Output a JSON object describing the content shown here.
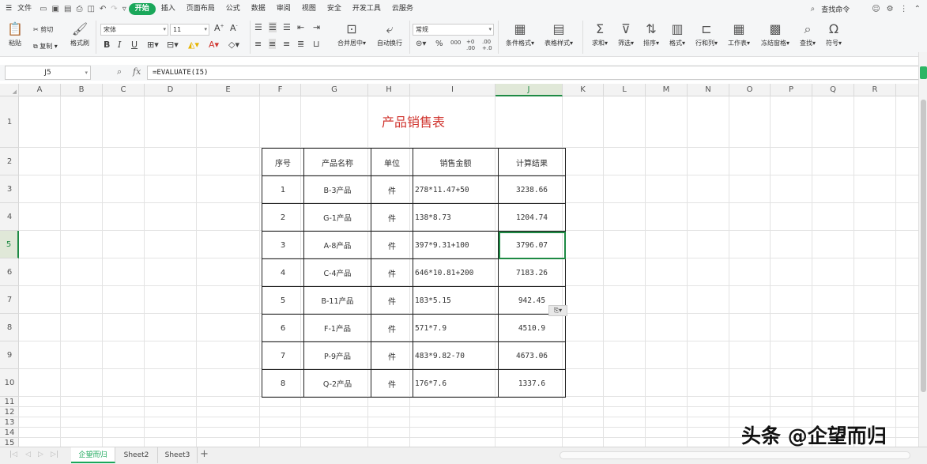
{
  "menubar": {
    "file": "文件",
    "tabs": [
      "开始",
      "插入",
      "页面布局",
      "公式",
      "数据",
      "审阅",
      "视图",
      "安全",
      "开发工具",
      "云服务"
    ],
    "active_tab": "开始",
    "search_cmd": "查找命令"
  },
  "ribbon": {
    "paste": "粘贴",
    "cut": "剪切",
    "copy": "复制",
    "format_painter": "格式刷",
    "font_name": "宋体",
    "font_size": "11",
    "merge_center": "合并居中",
    "wrap_text": "自动换行",
    "number_format": "常规",
    "cond_format": "条件格式",
    "table_style": "表格样式",
    "sum": "求和",
    "filter": "筛选",
    "sort": "排序",
    "format": "格式",
    "row_col": "行和列",
    "worksheet": "工作表",
    "freeze": "冻结窗格",
    "find": "查找",
    "symbol": "符号"
  },
  "formula_bar": {
    "name_box": "J5",
    "fx": "fx",
    "formula": "=EVALUATE(I5)"
  },
  "columns": [
    "A",
    "B",
    "C",
    "D",
    "E",
    "F",
    "G",
    "H",
    "I",
    "J",
    "K",
    "L",
    "M",
    "N",
    "O",
    "P",
    "Q",
    "R"
  ],
  "rows": [
    "1",
    "2",
    "3",
    "4",
    "5",
    "6",
    "7",
    "8",
    "9",
    "10",
    "11",
    "12",
    "13",
    "14",
    "15"
  ],
  "selected_cell": "J5",
  "sheet": {
    "title": "产品销售表",
    "headers": [
      "序号",
      "产品名称",
      "单位",
      "销售金额",
      "计算结果"
    ],
    "rows": [
      [
        "1",
        "B-3产品",
        "件",
        "278*11.47+50",
        "3238.66"
      ],
      [
        "2",
        "G-1产品",
        "件",
        "138*8.73",
        "1204.74"
      ],
      [
        "3",
        "A-8产品",
        "件",
        "397*9.31+100",
        "3796.07"
      ],
      [
        "4",
        "C-4产品",
        "件",
        "646*10.81+200",
        "7183.26"
      ],
      [
        "5",
        "B-11产品",
        "件",
        "183*5.15",
        "942.45"
      ],
      [
        "6",
        "F-1产品",
        "件",
        "571*7.9",
        "4510.9"
      ],
      [
        "7",
        "P-9产品",
        "件",
        "483*9.82-70",
        "4673.06"
      ],
      [
        "8",
        "Q-2产品",
        "件",
        "176*7.6",
        "1337.6"
      ]
    ]
  },
  "sheet_tabs": [
    "企望而归",
    "Sheet2",
    "Sheet3"
  ],
  "active_sheet": "企望而归",
  "watermark": "头条 @企望而归",
  "colors": {
    "accent": "#1aa75a",
    "title_red": "#d0352f",
    "selection": "#1e8a44"
  }
}
